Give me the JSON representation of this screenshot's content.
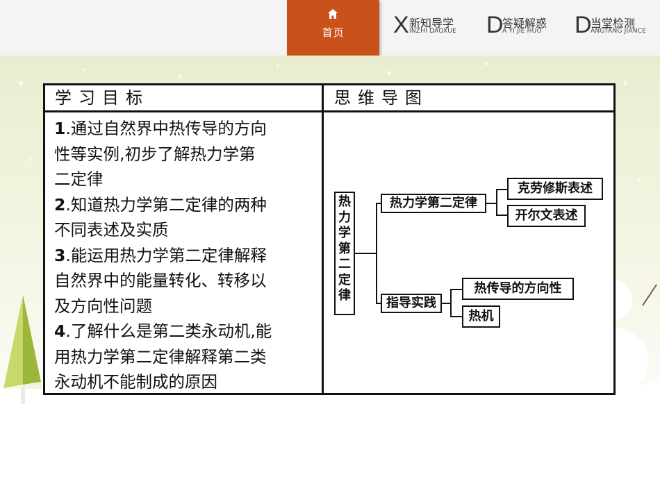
{
  "nav": {
    "home_label": "首页",
    "items": [
      {
        "letter": "X",
        "cn": "新知导学",
        "en": "INZHI DAOXUE"
      },
      {
        "letter": "D",
        "cn": "答疑解惑",
        "en": "A YI JIE HUO"
      },
      {
        "letter": "D",
        "cn": "当堂检测",
        "en": "ANGTANG JIANCE"
      }
    ]
  },
  "table": {
    "left_header": "学习目标",
    "right_header": "思维导图",
    "goals": [
      {
        "num": "1",
        "lines": [
          ".通过自然界中热传导的方向",
          "性等实例,初步了解热力学第",
          "二定律"
        ]
      },
      {
        "num": "2",
        "lines": [
          ".知道热力学第二定律的两种",
          "不同表述及实质"
        ]
      },
      {
        "num": "3",
        "lines": [
          ".能运用热力学第二定律解释",
          "自然界中的能量转化、转移以",
          "及方向性问题"
        ]
      },
      {
        "num": "4",
        "lines": [
          ".了解什么是第二类永动机,能",
          "用热力学第二定律解释第二类",
          "永动机不能制成的原因"
        ]
      }
    ]
  },
  "mindmap": {
    "root": "热力学第二定律",
    "branch1": "热力学第二定律",
    "b1_leaf1": "克劳修斯表述",
    "b1_leaf2": "开尔文表述",
    "branch2": "指导实践",
    "b2_leaf1": "热传导的方向性",
    "b2_leaf2": "热机"
  },
  "colors": {
    "accent": "#c9521b"
  }
}
